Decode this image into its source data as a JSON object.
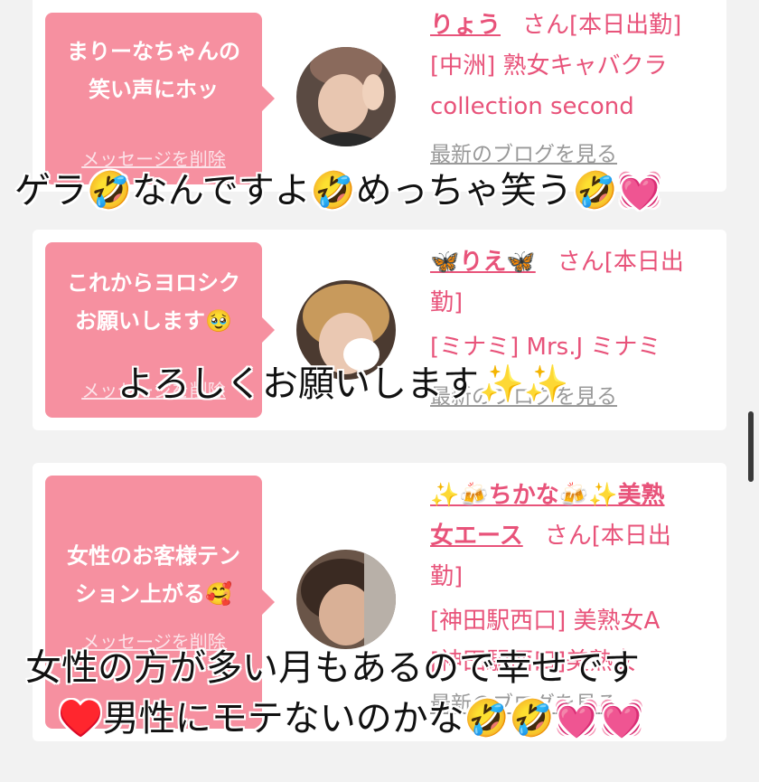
{
  "cards": [
    {
      "message": "まりーなちゃんの\n笑い声にホッ",
      "delete_label": "メッセージを削除",
      "name": "りょう",
      "name_suffix": "さん[本日出勤]",
      "lines": [
        "[中洲] 熟女キャバクラ",
        "collection second"
      ],
      "blog_label": "最新のブログを見る"
    },
    {
      "message": "これからヨロシク\nお願いします🥹",
      "delete_label": "メッセージを削除",
      "name": "🦋りえ🦋",
      "name_suffix": "さん[本日出",
      "lines": [
        "勤]",
        "[ミナミ] Mrs.J ミナミ"
      ],
      "blog_label": "最新のブログを見る"
    },
    {
      "message": "女性のお客様テン\nション上がる🥰",
      "delete_label": "メッセージを削除",
      "name_line1": "✨🍻ちかな🍻✨美熟",
      "name_line2": "女エース",
      "name_suffix": "さん[本日出",
      "lines": [
        "勤]",
        "[神田駅西口] 美熟女A",
        "[神田駅西口]美熟女"
      ],
      "blog_label": "最新のブログを見る"
    }
  ],
  "captions": {
    "caption1": "ゲラ🤣なんですよ🤣めっちゃ笑う🤣💓",
    "caption2": "よろしくお願いします✨✨",
    "caption3_line1": "女性の方が多い月もあるので幸せです",
    "caption3_line2": "♥️男性にモテないのかな🤣🤣💓💓"
  },
  "colors": {
    "accent": "#e8537a",
    "bubble": "#f690a0",
    "background": "#f2f2f2"
  }
}
